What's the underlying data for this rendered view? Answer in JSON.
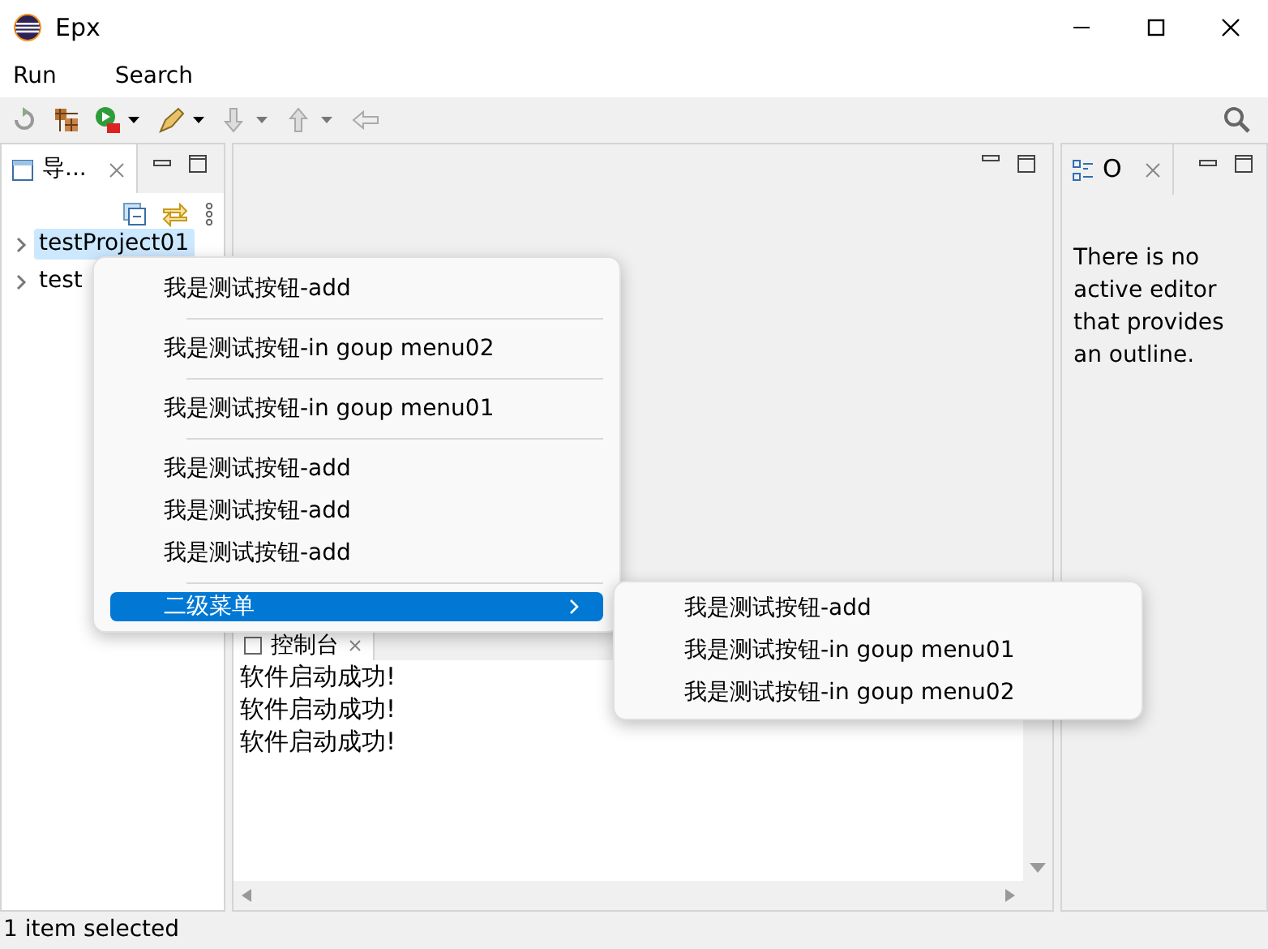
{
  "window": {
    "title": "Epx"
  },
  "menu_bar": [
    "Run",
    "Search"
  ],
  "navigator": {
    "tab_label": "导...",
    "tree": [
      {
        "label": "testProject01",
        "selected": true
      },
      {
        "label": "test",
        "selected": false
      }
    ]
  },
  "console": {
    "tab_label": "控制台",
    "lines": [
      "软件启动成功!",
      "软件启动成功!",
      "软件启动成功!"
    ]
  },
  "outline": {
    "tab_label": "O",
    "message": "There is no active editor that provides an outline."
  },
  "context_menu": {
    "items": [
      {
        "kind": "item",
        "label": "我是测试按钮-add",
        "selected": false
      },
      {
        "kind": "separator"
      },
      {
        "kind": "item",
        "label": "我是测试按钮-in goup menu02",
        "selected": false
      },
      {
        "kind": "separator"
      },
      {
        "kind": "item",
        "label": "我是测试按钮-in goup menu01",
        "selected": false
      },
      {
        "kind": "separator"
      },
      {
        "kind": "item",
        "label": "我是测试按钮-add",
        "selected": false
      },
      {
        "kind": "item",
        "label": "我是测试按钮-add",
        "selected": false
      },
      {
        "kind": "item",
        "label": "我是测试按钮-add",
        "selected": false
      },
      {
        "kind": "separator"
      },
      {
        "kind": "submenu",
        "label": "二级菜单",
        "selected": true
      }
    ]
  },
  "submenu": {
    "items": [
      {
        "label": "我是测试按钮-add",
        "selected": false
      },
      {
        "label": "我是测试按钮-in goup menu01",
        "selected": false
      },
      {
        "label": "我是测试按钮-in goup menu02",
        "selected": false
      }
    ]
  },
  "status_bar": "1 item selected"
}
